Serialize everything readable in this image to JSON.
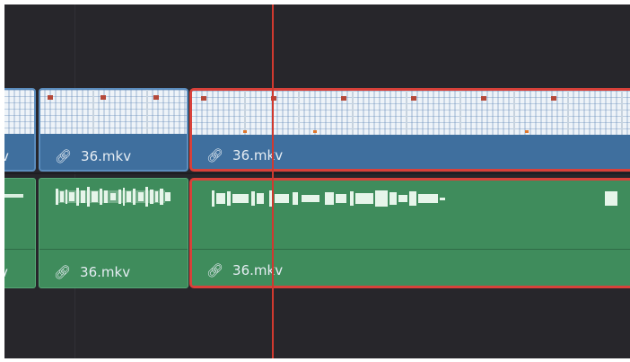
{
  "timeline": {
    "video_track": {
      "clips": [
        {
          "label": "v",
          "selected": false
        },
        {
          "label": "36.mkv",
          "selected": false
        },
        {
          "label": "36.mkv",
          "selected": true
        }
      ]
    },
    "audio_track": {
      "clips": [
        {
          "label": "v",
          "selected": false
        },
        {
          "label": "36.mkv",
          "selected": false
        },
        {
          "label": "36.mkv",
          "selected": true
        }
      ]
    },
    "link_icon_glyph": "ℐ"
  },
  "colors": {
    "timeline_bg": "#27262b",
    "video_clip": "#3f6f9e",
    "audio_clip": "#3f8c5c",
    "selection_outline": "#d8413a",
    "playhead": "#d0392f"
  }
}
